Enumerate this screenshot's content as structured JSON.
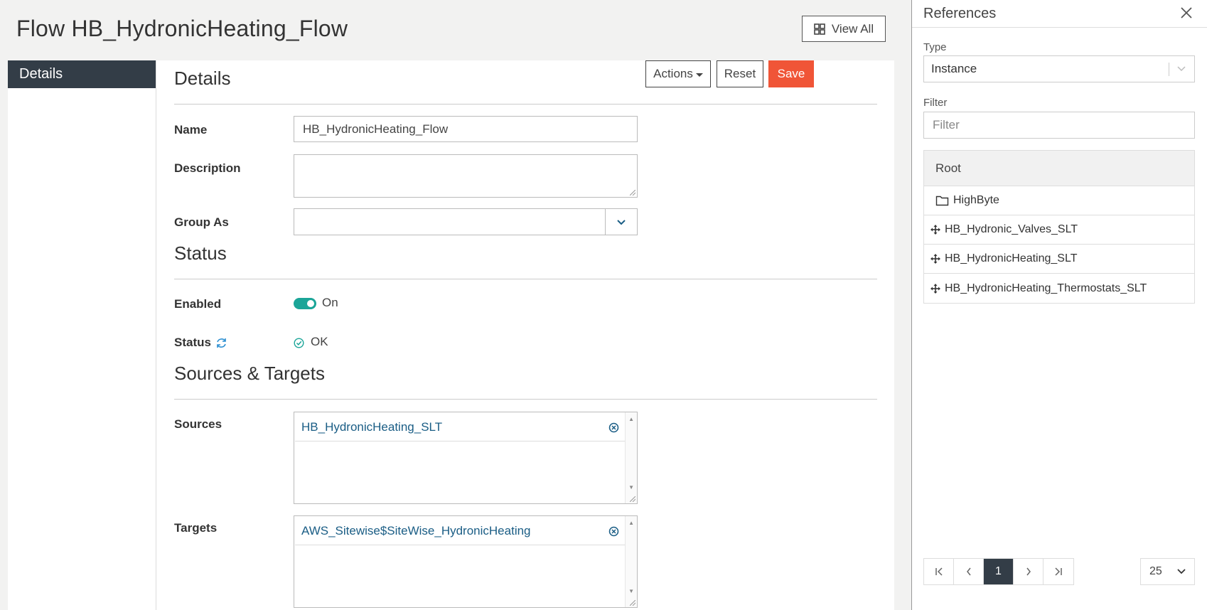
{
  "page": {
    "title": "Flow HB_HydronicHeating_Flow",
    "view_all_label": "View All"
  },
  "sidebar": {
    "items": [
      {
        "label": "Details",
        "active": true
      }
    ]
  },
  "details": {
    "title": "Details",
    "actions_label": "Actions",
    "reset_label": "Reset",
    "save_label": "Save",
    "name_label": "Name",
    "name_value": "HB_HydronicHeating_Flow",
    "description_label": "Description",
    "description_value": "",
    "group_label": "Group As",
    "group_value": ""
  },
  "status": {
    "title": "Status",
    "enabled_label": "Enabled",
    "enabled_text": "On",
    "enabled": true,
    "status_label": "Status",
    "status_value": "OK"
  },
  "sources_targets": {
    "title": "Sources & Targets",
    "sources_label": "Sources",
    "sources": [
      "HB_HydronicHeating_SLT"
    ],
    "targets_label": "Targets",
    "targets": [
      "AWS_Sitewise$SiteWise_HydronicHeating"
    ]
  },
  "references": {
    "title": "References",
    "type_label": "Type",
    "type_value": "Instance",
    "filter_label": "Filter",
    "filter_placeholder": "Filter",
    "tree_root": "Root",
    "tree_items": [
      {
        "label": "HighByte",
        "icon": "folder-icon"
      },
      {
        "label": "HB_Hydronic_Valves_SLT",
        "icon": "move-icon"
      },
      {
        "label": "HB_HydronicHeating_SLT",
        "icon": "move-icon"
      },
      {
        "label": "HB_HydronicHeating_Thermostats_SLT",
        "icon": "move-icon"
      }
    ],
    "pagination": {
      "current_page": "1",
      "page_size": "25"
    }
  },
  "colors": {
    "accent_save": "#f05537",
    "toggle_on": "#1ba598",
    "nav_active": "#333d47",
    "link": "#1a5d85"
  }
}
